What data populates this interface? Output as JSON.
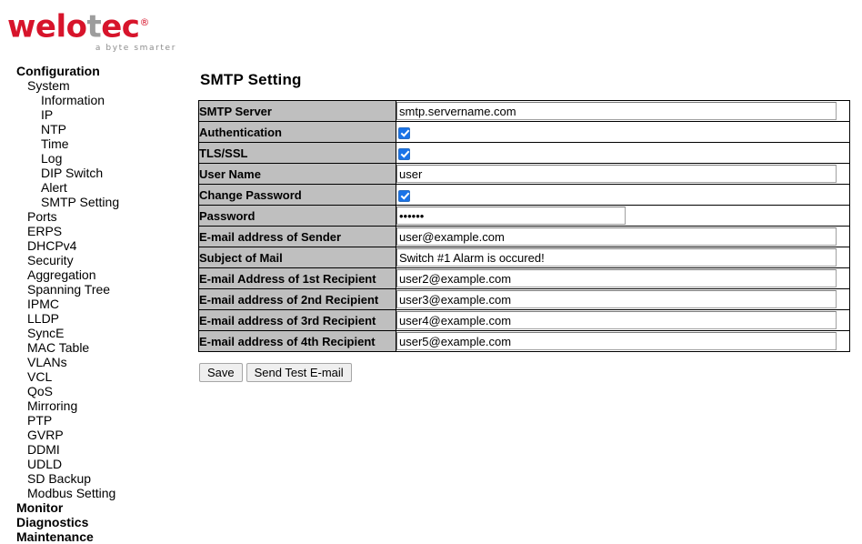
{
  "logo": {
    "part1": "welo",
    "part2": "T",
    "part3": "ec",
    "trademark": "®",
    "tagline": "a byte smarter",
    "red": "#d7142b",
    "gray": "#9d9d9d"
  },
  "sidebar": {
    "items": [
      {
        "label": "Configuration",
        "level": 0
      },
      {
        "label": "System",
        "level": 1
      },
      {
        "label": "Information",
        "level": 2
      },
      {
        "label": "IP",
        "level": 2
      },
      {
        "label": "NTP",
        "level": 2
      },
      {
        "label": "Time",
        "level": 2
      },
      {
        "label": "Log",
        "level": 2
      },
      {
        "label": "DIP Switch",
        "level": 2
      },
      {
        "label": "Alert",
        "level": 2
      },
      {
        "label": "SMTP Setting",
        "level": 2
      },
      {
        "label": "Ports",
        "level": 1
      },
      {
        "label": "ERPS",
        "level": 1
      },
      {
        "label": "DHCPv4",
        "level": 1
      },
      {
        "label": "Security",
        "level": 1
      },
      {
        "label": "Aggregation",
        "level": 1
      },
      {
        "label": "Spanning Tree",
        "level": 1
      },
      {
        "label": "IPMC",
        "level": 1
      },
      {
        "label": "LLDP",
        "level": 1
      },
      {
        "label": "SyncE",
        "level": 1
      },
      {
        "label": "MAC Table",
        "level": 1
      },
      {
        "label": "VLANs",
        "level": 1
      },
      {
        "label": "VCL",
        "level": 1
      },
      {
        "label": "QoS",
        "level": 1
      },
      {
        "label": "Mirroring",
        "level": 1
      },
      {
        "label": "PTP",
        "level": 1
      },
      {
        "label": "GVRP",
        "level": 1
      },
      {
        "label": "DDMI",
        "level": 1
      },
      {
        "label": "UDLD",
        "level": 1
      },
      {
        "label": "SD Backup",
        "level": 1
      },
      {
        "label": "Modbus Setting",
        "level": 1
      },
      {
        "label": "Monitor",
        "level": 0
      },
      {
        "label": "Diagnostics",
        "level": 0
      },
      {
        "label": "Maintenance",
        "level": 0
      }
    ]
  },
  "main": {
    "title": "SMTP Setting",
    "rows": [
      {
        "label": "SMTP Server",
        "type": "text",
        "value": "smtp.servername.com",
        "width": "wide"
      },
      {
        "label": "Authentication",
        "type": "checkbox",
        "checked": true
      },
      {
        "label": "TLS/SSL",
        "type": "checkbox",
        "checked": true
      },
      {
        "label": "User Name",
        "type": "text",
        "value": "user",
        "width": "wide"
      },
      {
        "label": "Change Password",
        "type": "checkbox",
        "checked": true
      },
      {
        "label": "Password",
        "type": "password",
        "value": "abc123",
        "width": "narrow"
      },
      {
        "label": "E-mail address of Sender",
        "type": "text",
        "value": "user@example.com",
        "width": "wide"
      },
      {
        "label": "Subject of Mail",
        "type": "text",
        "value": "Switch #1 Alarm is occured!",
        "width": "wide"
      },
      {
        "label": "E-mail Address of 1st Recipient",
        "type": "text",
        "value": "user2@example.com",
        "width": "wide"
      },
      {
        "label": "E-mail address of 2nd Recipient",
        "type": "text",
        "value": "user3@example.com",
        "width": "wide"
      },
      {
        "label": "E-mail address of 3rd Recipient",
        "type": "text",
        "value": "user4@example.com",
        "width": "wide"
      },
      {
        "label": "E-mail address of 4th Recipient",
        "type": "text",
        "value": "user5@example.com",
        "width": "wide"
      }
    ],
    "buttons": [
      {
        "label": "Save",
        "name": "save-button"
      },
      {
        "label": "Send Test E-mail",
        "name": "send-test-email-button"
      }
    ]
  }
}
